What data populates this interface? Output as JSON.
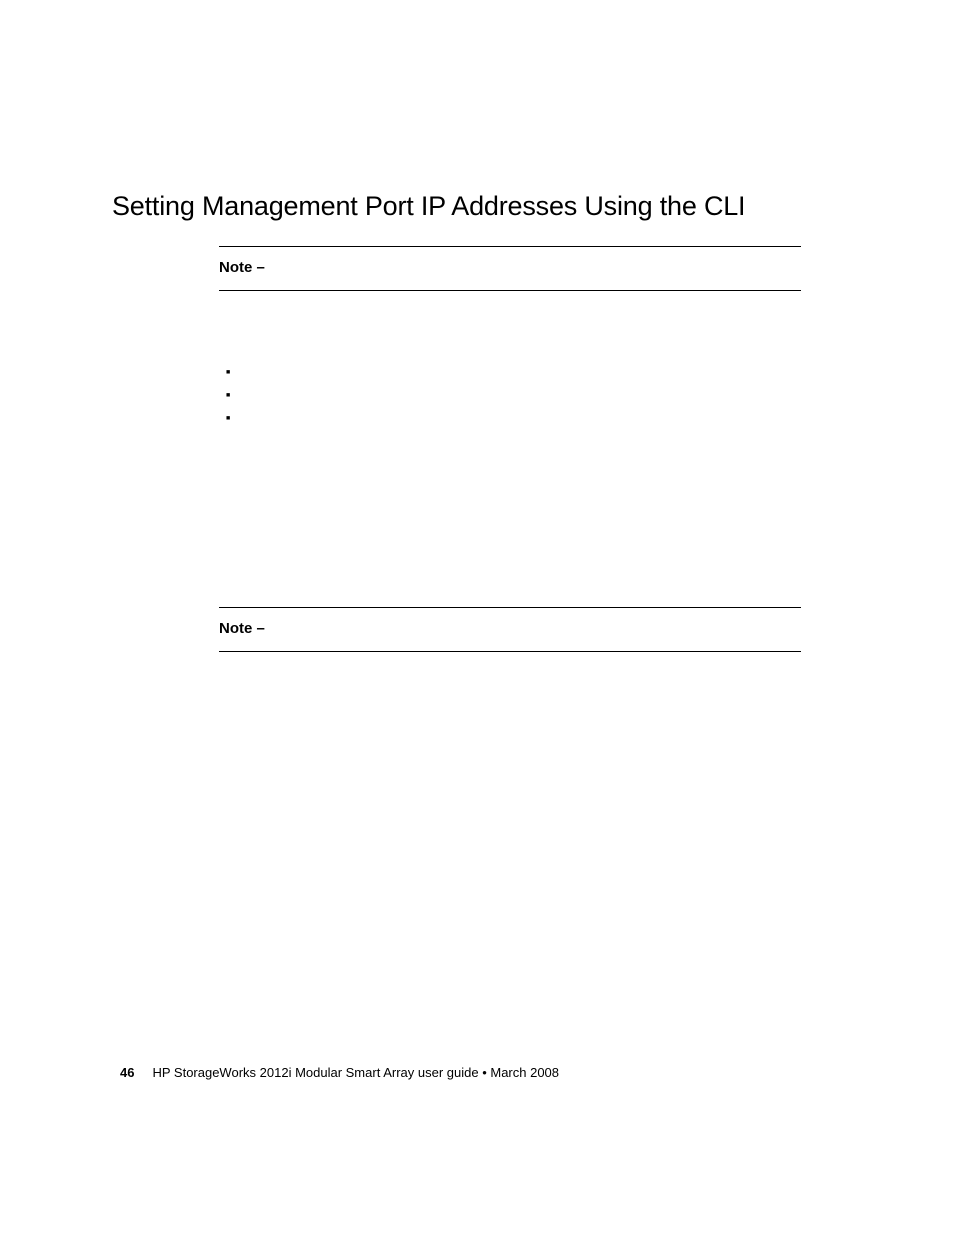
{
  "heading": "Setting Management Port IP Addresses Using the CLI",
  "note1": {
    "label": "Note –"
  },
  "note2": {
    "label": "Note –"
  },
  "footer": {
    "pageNumber": "46",
    "text": "HP StorageWorks 2012i Modular Smart Array user guide  •  March 2008"
  }
}
